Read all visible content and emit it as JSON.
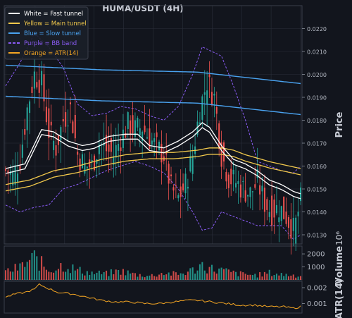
{
  "chart_data": {
    "type": "candlestick",
    "title": "HUMA/USDT (4H)",
    "panels": {
      "price": {
        "ylabel": "Price",
        "ylim": [
          0.0126,
          0.023
        ],
        "ticks": [
          "0.0130",
          "0.0140",
          "0.0150",
          "0.0160",
          "0.0170",
          "0.0180",
          "0.0190",
          "0.0200",
          "0.0210",
          "0.0220"
        ],
        "tick_values": [
          0.013,
          0.014,
          0.015,
          0.016,
          0.017,
          0.018,
          0.019,
          0.02,
          0.021,
          0.022
        ]
      },
      "volume": {
        "ylabel": "Volume",
        "exponent": "10⁶",
        "ylim": [
          0,
          2600
        ],
        "ticks": [
          "1000",
          "2000"
        ],
        "tick_values": [
          1000,
          2000
        ]
      },
      "atr": {
        "ylabel": "ATR(14)",
        "ylim": [
          0.0004,
          0.0024
        ],
        "ticks": [
          "0.001",
          "0.002"
        ],
        "tick_values": [
          0.001,
          0.002
        ]
      }
    },
    "legend": {
      "placement": "top-left",
      "entries": [
        {
          "label": "White = Fast tunnel",
          "color": "#ffffff",
          "style": "solid"
        },
        {
          "label": "Yellow = Main tunnel",
          "color": "#f2c94c",
          "style": "solid"
        },
        {
          "label": "Blue = Slow tunnel",
          "color": "#4aa3f0",
          "style": "solid"
        },
        {
          "label": "Purple = BB band",
          "color": "#8b5cf6",
          "style": "dashed"
        },
        {
          "label": "Orange = ATR(14)",
          "color": "#f5a623",
          "style": "solid"
        }
      ]
    },
    "colors": {
      "up": "#26a69a",
      "down": "#ef5350",
      "fast": "#ffffff",
      "main": "#f2c94c",
      "slow": "#4aa3f0",
      "bb": "#8b5cf6",
      "atr": "#f5a623",
      "grid": "#2a2f3a",
      "background": "#12151d"
    },
    "grid": true,
    "series_anchors": {
      "close": [
        [
          0,
          0.0158
        ],
        [
          3,
          0.0156
        ],
        [
          6,
          0.0163
        ],
        [
          9,
          0.0185
        ],
        [
          12,
          0.02
        ],
        [
          15,
          0.0196
        ],
        [
          18,
          0.0175
        ],
        [
          21,
          0.0168
        ],
        [
          24,
          0.018
        ],
        [
          27,
          0.0185
        ],
        [
          30,
          0.0165
        ],
        [
          33,
          0.016
        ],
        [
          36,
          0.016
        ],
        [
          39,
          0.017
        ],
        [
          42,
          0.0167
        ],
        [
          45,
          0.0165
        ],
        [
          48,
          0.0172
        ],
        [
          51,
          0.0178
        ],
        [
          54,
          0.0176
        ],
        [
          57,
          0.0177
        ],
        [
          60,
          0.0172
        ],
        [
          63,
          0.0168
        ],
        [
          66,
          0.0165
        ],
        [
          69,
          0.015
        ],
        [
          72,
          0.0146
        ],
        [
          75,
          0.0152
        ],
        [
          78,
          0.0165
        ],
        [
          81,
          0.0185
        ],
        [
          84,
          0.0197
        ],
        [
          87,
          0.019
        ],
        [
          90,
          0.0165
        ],
        [
          93,
          0.0155
        ],
        [
          96,
          0.0153
        ],
        [
          99,
          0.015
        ],
        [
          102,
          0.0148
        ],
        [
          105,
          0.0153
        ],
        [
          108,
          0.0144
        ],
        [
          111,
          0.014
        ],
        [
          114,
          0.0142
        ],
        [
          117,
          0.0138
        ],
        [
          120,
          0.0132
        ],
        [
          121,
          0.0135
        ],
        [
          122,
          0.014
        ],
        [
          123,
          0.0145
        ]
      ],
      "fast": [
        [
          0,
          0.0158
        ],
        [
          8,
          0.016
        ],
        [
          15,
          0.0175
        ],
        [
          20,
          0.0174
        ],
        [
          26,
          0.017
        ],
        [
          32,
          0.0168
        ],
        [
          37,
          0.0169
        ],
        [
          43,
          0.0172
        ],
        [
          50,
          0.0173
        ],
        [
          55,
          0.0173
        ],
        [
          60,
          0.0168
        ],
        [
          66,
          0.0167
        ],
        [
          72,
          0.017
        ],
        [
          78,
          0.0174
        ],
        [
          82,
          0.0178
        ],
        [
          85,
          0.0176
        ],
        [
          90,
          0.0168
        ],
        [
          95,
          0.0162
        ],
        [
          100,
          0.016
        ],
        [
          105,
          0.0157
        ],
        [
          110,
          0.0153
        ],
        [
          115,
          0.0151
        ],
        [
          120,
          0.0148
        ],
        [
          123,
          0.0147
        ]
      ],
      "main": [
        [
          0,
          0.0151
        ],
        [
          10,
          0.0153
        ],
        [
          20,
          0.0157
        ],
        [
          30,
          0.0159
        ],
        [
          40,
          0.0162
        ],
        [
          50,
          0.0164
        ],
        [
          60,
          0.0165
        ],
        [
          70,
          0.0165
        ],
        [
          80,
          0.0166
        ],
        [
          85,
          0.0167
        ],
        [
          90,
          0.0167
        ],
        [
          95,
          0.0166
        ],
        [
          100,
          0.0164
        ],
        [
          110,
          0.0161
        ],
        [
          123,
          0.0158
        ]
      ],
      "slow": [
        [
          0,
          0.0204
        ],
        [
          40,
          0.0202
        ],
        [
          80,
          0.0201
        ],
        [
          123,
          0.0196
        ]
      ],
      "bb_upper": [
        [
          0,
          0.0195
        ],
        [
          6,
          0.0205
        ],
        [
          12,
          0.0218
        ],
        [
          18,
          0.0212
        ],
        [
          24,
          0.0203
        ],
        [
          30,
          0.0187
        ],
        [
          36,
          0.0182
        ],
        [
          42,
          0.0183
        ],
        [
          48,
          0.0186
        ],
        [
          54,
          0.0185
        ],
        [
          60,
          0.0182
        ],
        [
          66,
          0.018
        ],
        [
          72,
          0.0186
        ],
        [
          78,
          0.02
        ],
        [
          82,
          0.0212
        ],
        [
          86,
          0.021
        ],
        [
          90,
          0.0208
        ],
        [
          95,
          0.0195
        ],
        [
          100,
          0.018
        ],
        [
          105,
          0.0162
        ],
        [
          110,
          0.016
        ],
        [
          115,
          0.0158
        ],
        [
          120,
          0.0157
        ],
        [
          123,
          0.016
        ]
      ],
      "bb_lower": [
        [
          0,
          0.0143
        ],
        [
          6,
          0.014
        ],
        [
          12,
          0.0142
        ],
        [
          18,
          0.0143
        ],
        [
          24,
          0.015
        ],
        [
          30,
          0.0152
        ],
        [
          36,
          0.0155
        ],
        [
          42,
          0.0158
        ],
        [
          48,
          0.016
        ],
        [
          54,
          0.0162
        ],
        [
          60,
          0.016
        ],
        [
          66,
          0.0157
        ],
        [
          72,
          0.015
        ],
        [
          78,
          0.014
        ],
        [
          82,
          0.0132
        ],
        [
          86,
          0.0133
        ],
        [
          90,
          0.014
        ],
        [
          95,
          0.0138
        ],
        [
          100,
          0.0136
        ],
        [
          105,
          0.0134
        ],
        [
          110,
          0.0134
        ],
        [
          115,
          0.0134
        ],
        [
          120,
          0.0128
        ],
        [
          123,
          0.013
        ]
      ],
      "volume": [
        [
          0,
          600
        ],
        [
          6,
          900
        ],
        [
          12,
          1600
        ],
        [
          18,
          700
        ],
        [
          24,
          1100
        ],
        [
          30,
          700
        ],
        [
          36,
          500
        ],
        [
          42,
          450
        ],
        [
          48,
          650
        ],
        [
          54,
          400
        ],
        [
          60,
          300
        ],
        [
          66,
          500
        ],
        [
          72,
          400
        ],
        [
          78,
          700
        ],
        [
          82,
          1100
        ],
        [
          86,
          800
        ],
        [
          90,
          700
        ],
        [
          95,
          500
        ],
        [
          100,
          400
        ],
        [
          105,
          350
        ],
        [
          110,
          500
        ],
        [
          115,
          400
        ],
        [
          120,
          350
        ],
        [
          123,
          300
        ]
      ],
      "atr": [
        [
          0,
          0.0014
        ],
        [
          4,
          0.0016
        ],
        [
          8,
          0.0017
        ],
        [
          12,
          0.0019
        ],
        [
          14,
          0.0022
        ],
        [
          17,
          0.002
        ],
        [
          22,
          0.0017
        ],
        [
          28,
          0.0016
        ],
        [
          34,
          0.0014
        ],
        [
          40,
          0.0012
        ],
        [
          46,
          0.0011
        ],
        [
          52,
          0.0011
        ],
        [
          58,
          0.001
        ],
        [
          64,
          0.001
        ],
        [
          70,
          0.0011
        ],
        [
          76,
          0.0012
        ],
        [
          80,
          0.0012
        ],
        [
          86,
          0.0011
        ],
        [
          92,
          0.001
        ],
        [
          98,
          0.0009
        ],
        [
          104,
          0.0009
        ],
        [
          110,
          0.0008
        ],
        [
          116,
          0.0008
        ],
        [
          120,
          0.0007
        ],
        [
          123,
          0.0008
        ]
      ]
    },
    "n_candles": 124
  }
}
